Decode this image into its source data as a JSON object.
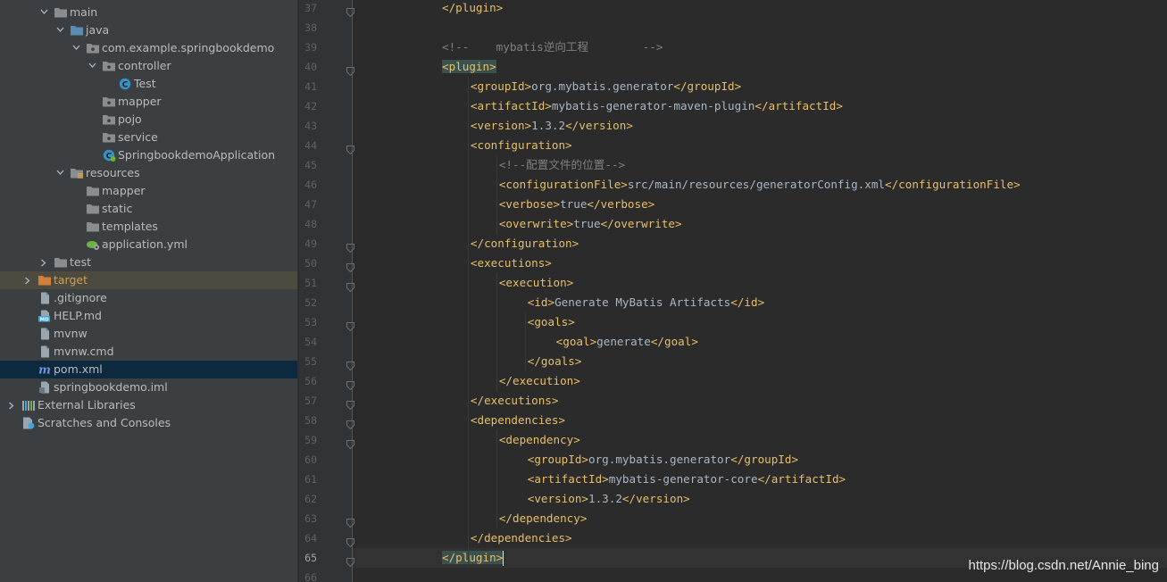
{
  "colors": {
    "tree_bg": "#3c3f41",
    "editor_bg": "#2b2b2b",
    "gutter_bg": "#313335",
    "tag": "#e8bf6a",
    "comment": "#808080",
    "text": "#a9b7c6",
    "selection_target": "#4d4a3f",
    "selection_pom": "#0d293e",
    "folder_blue": "#5e8bb4",
    "folder_grey": "#8a8e91",
    "folder_orange": "#d0803a"
  },
  "project_tree": [
    {
      "label": "main",
      "icon": "folder-icon",
      "arrow": "down",
      "level": 3
    },
    {
      "label": "java",
      "icon": "source-folder-icon",
      "arrow": "down",
      "level": 4
    },
    {
      "label": "com.example.springbookdemo",
      "icon": "package-icon",
      "arrow": "down",
      "level": 5
    },
    {
      "label": "controller",
      "icon": "package-icon",
      "arrow": "down",
      "level": 6
    },
    {
      "label": "Test",
      "icon": "class-icon",
      "arrow": "",
      "level": 7
    },
    {
      "label": "mapper",
      "icon": "package-icon",
      "arrow": "",
      "level": 6
    },
    {
      "label": "pojo",
      "icon": "package-icon",
      "arrow": "",
      "level": 6
    },
    {
      "label": "service",
      "icon": "package-icon",
      "arrow": "",
      "level": 6
    },
    {
      "label": "SpringbookdemoApplication",
      "icon": "spring-boot-class-icon",
      "arrow": "",
      "level": 6
    },
    {
      "label": "resources",
      "icon": "resources-folder-icon",
      "arrow": "down",
      "level": 4
    },
    {
      "label": "mapper",
      "icon": "folder-icon",
      "arrow": "",
      "level": 5
    },
    {
      "label": "static",
      "icon": "folder-icon",
      "arrow": "",
      "level": 5
    },
    {
      "label": "templates",
      "icon": "folder-icon",
      "arrow": "",
      "level": 5
    },
    {
      "label": "application.yml",
      "icon": "spring-yml-icon",
      "arrow": "",
      "level": 5
    },
    {
      "label": "test",
      "icon": "folder-icon",
      "arrow": "right",
      "level": 3
    },
    {
      "label": "target",
      "icon": "excluded-folder-icon",
      "arrow": "right",
      "level": 2
    },
    {
      "label": ".gitignore",
      "icon": "file-icon",
      "arrow": "",
      "level": 2
    },
    {
      "label": "HELP.md",
      "icon": "markdown-icon",
      "arrow": "",
      "level": 2
    },
    {
      "label": "mvnw",
      "icon": "file-icon",
      "arrow": "",
      "level": 2
    },
    {
      "label": "mvnw.cmd",
      "icon": "file-icon",
      "arrow": "",
      "level": 2
    },
    {
      "label": "pom.xml",
      "icon": "maven-icon",
      "arrow": "",
      "level": 2
    },
    {
      "label": "springbookdemo.iml",
      "icon": "iml-file-icon",
      "arrow": "",
      "level": 2
    },
    {
      "label": "External Libraries",
      "icon": "libraries-icon",
      "arrow": "right",
      "level": 1
    },
    {
      "label": "Scratches and Consoles",
      "icon": "scratches-icon",
      "arrow": "",
      "level": 1
    }
  ],
  "editor": {
    "current_line": 65,
    "lines": [
      {
        "n": 37,
        "indent": 3,
        "parts": [
          [
            "tag",
            "</plugin>"
          ]
        ]
      },
      {
        "n": 38,
        "indent": 0,
        "parts": []
      },
      {
        "n": 39,
        "indent": 3,
        "parts": [
          [
            "cmt",
            "<!--    mybatis逆向工程        -->"
          ]
        ]
      },
      {
        "n": 40,
        "indent": 3,
        "parts": [
          [
            "tagm",
            "<plugin>"
          ]
        ]
      },
      {
        "n": 41,
        "indent": 4,
        "parts": [
          [
            "tag",
            "<groupId>"
          ],
          [
            "txt",
            "org.mybatis.generator"
          ],
          [
            "tag",
            "</groupId>"
          ]
        ]
      },
      {
        "n": 42,
        "indent": 4,
        "parts": [
          [
            "tag",
            "<artifactId>"
          ],
          [
            "txt",
            "mybatis-generator-maven-plugin"
          ],
          [
            "tag",
            "</artifactId>"
          ]
        ]
      },
      {
        "n": 43,
        "indent": 4,
        "parts": [
          [
            "tag",
            "<version>"
          ],
          [
            "txt",
            "1.3.2"
          ],
          [
            "tag",
            "</version>"
          ]
        ]
      },
      {
        "n": 44,
        "indent": 4,
        "parts": [
          [
            "tag",
            "<configuration>"
          ]
        ]
      },
      {
        "n": 45,
        "indent": 5,
        "parts": [
          [
            "cmt",
            "<!--配置文件的位置-->"
          ]
        ]
      },
      {
        "n": 46,
        "indent": 5,
        "parts": [
          [
            "tag",
            "<configurationFile>"
          ],
          [
            "txt",
            "src/main/resources/generatorConfig.xml"
          ],
          [
            "tag",
            "</configurationFile>"
          ]
        ]
      },
      {
        "n": 47,
        "indent": 5,
        "parts": [
          [
            "tag",
            "<verbose>"
          ],
          [
            "txt",
            "true"
          ],
          [
            "tag",
            "</verbose>"
          ]
        ]
      },
      {
        "n": 48,
        "indent": 5,
        "parts": [
          [
            "tag",
            "<overwrite>"
          ],
          [
            "txt",
            "true"
          ],
          [
            "tag",
            "</overwrite>"
          ]
        ]
      },
      {
        "n": 49,
        "indent": 4,
        "parts": [
          [
            "tag",
            "</configuration>"
          ]
        ]
      },
      {
        "n": 50,
        "indent": 4,
        "parts": [
          [
            "tag",
            "<executions>"
          ]
        ]
      },
      {
        "n": 51,
        "indent": 5,
        "parts": [
          [
            "tag",
            "<execution>"
          ]
        ]
      },
      {
        "n": 52,
        "indent": 6,
        "parts": [
          [
            "tag",
            "<id>"
          ],
          [
            "txt",
            "Generate MyBatis Artifacts"
          ],
          [
            "tag",
            "</id>"
          ]
        ]
      },
      {
        "n": 53,
        "indent": 6,
        "parts": [
          [
            "tag",
            "<goals>"
          ]
        ]
      },
      {
        "n": 54,
        "indent": 7,
        "parts": [
          [
            "tag",
            "<goal>"
          ],
          [
            "txt",
            "generate"
          ],
          [
            "tag",
            "</goal>"
          ]
        ]
      },
      {
        "n": 55,
        "indent": 6,
        "parts": [
          [
            "tag",
            "</goals>"
          ]
        ]
      },
      {
        "n": 56,
        "indent": 5,
        "parts": [
          [
            "tag",
            "</execution>"
          ]
        ]
      },
      {
        "n": 57,
        "indent": 4,
        "parts": [
          [
            "tag",
            "</executions>"
          ]
        ]
      },
      {
        "n": 58,
        "indent": 4,
        "parts": [
          [
            "tag",
            "<dependencies>"
          ]
        ]
      },
      {
        "n": 59,
        "indent": 5,
        "parts": [
          [
            "tag",
            "<dependency>"
          ]
        ]
      },
      {
        "n": 60,
        "indent": 6,
        "parts": [
          [
            "tag",
            "<groupId>"
          ],
          [
            "txt",
            "org.mybatis.generator"
          ],
          [
            "tag",
            "</groupId>"
          ]
        ]
      },
      {
        "n": 61,
        "indent": 6,
        "parts": [
          [
            "tag",
            "<artifactId>"
          ],
          [
            "txt",
            "mybatis-generator-core"
          ],
          [
            "tag",
            "</artifactId>"
          ]
        ]
      },
      {
        "n": 62,
        "indent": 6,
        "parts": [
          [
            "tag",
            "<version>"
          ],
          [
            "txt",
            "1.3.2"
          ],
          [
            "tag",
            "</version>"
          ]
        ]
      },
      {
        "n": 63,
        "indent": 5,
        "parts": [
          [
            "tag",
            "</dependency>"
          ]
        ]
      },
      {
        "n": 64,
        "indent": 4,
        "parts": [
          [
            "tag",
            "</dependencies>"
          ]
        ]
      },
      {
        "n": 65,
        "indent": 3,
        "parts": [
          [
            "tagm",
            "</plugin>"
          ],
          [
            "caret",
            ""
          ]
        ]
      },
      {
        "n": 66,
        "indent": 0,
        "parts": []
      }
    ],
    "fold_lines": [
      37,
      40,
      44,
      49,
      50,
      51,
      53,
      55,
      56,
      57,
      58,
      59,
      63,
      64,
      65
    ]
  },
  "watermark": "https://blog.csdn.net/Annie_bing"
}
